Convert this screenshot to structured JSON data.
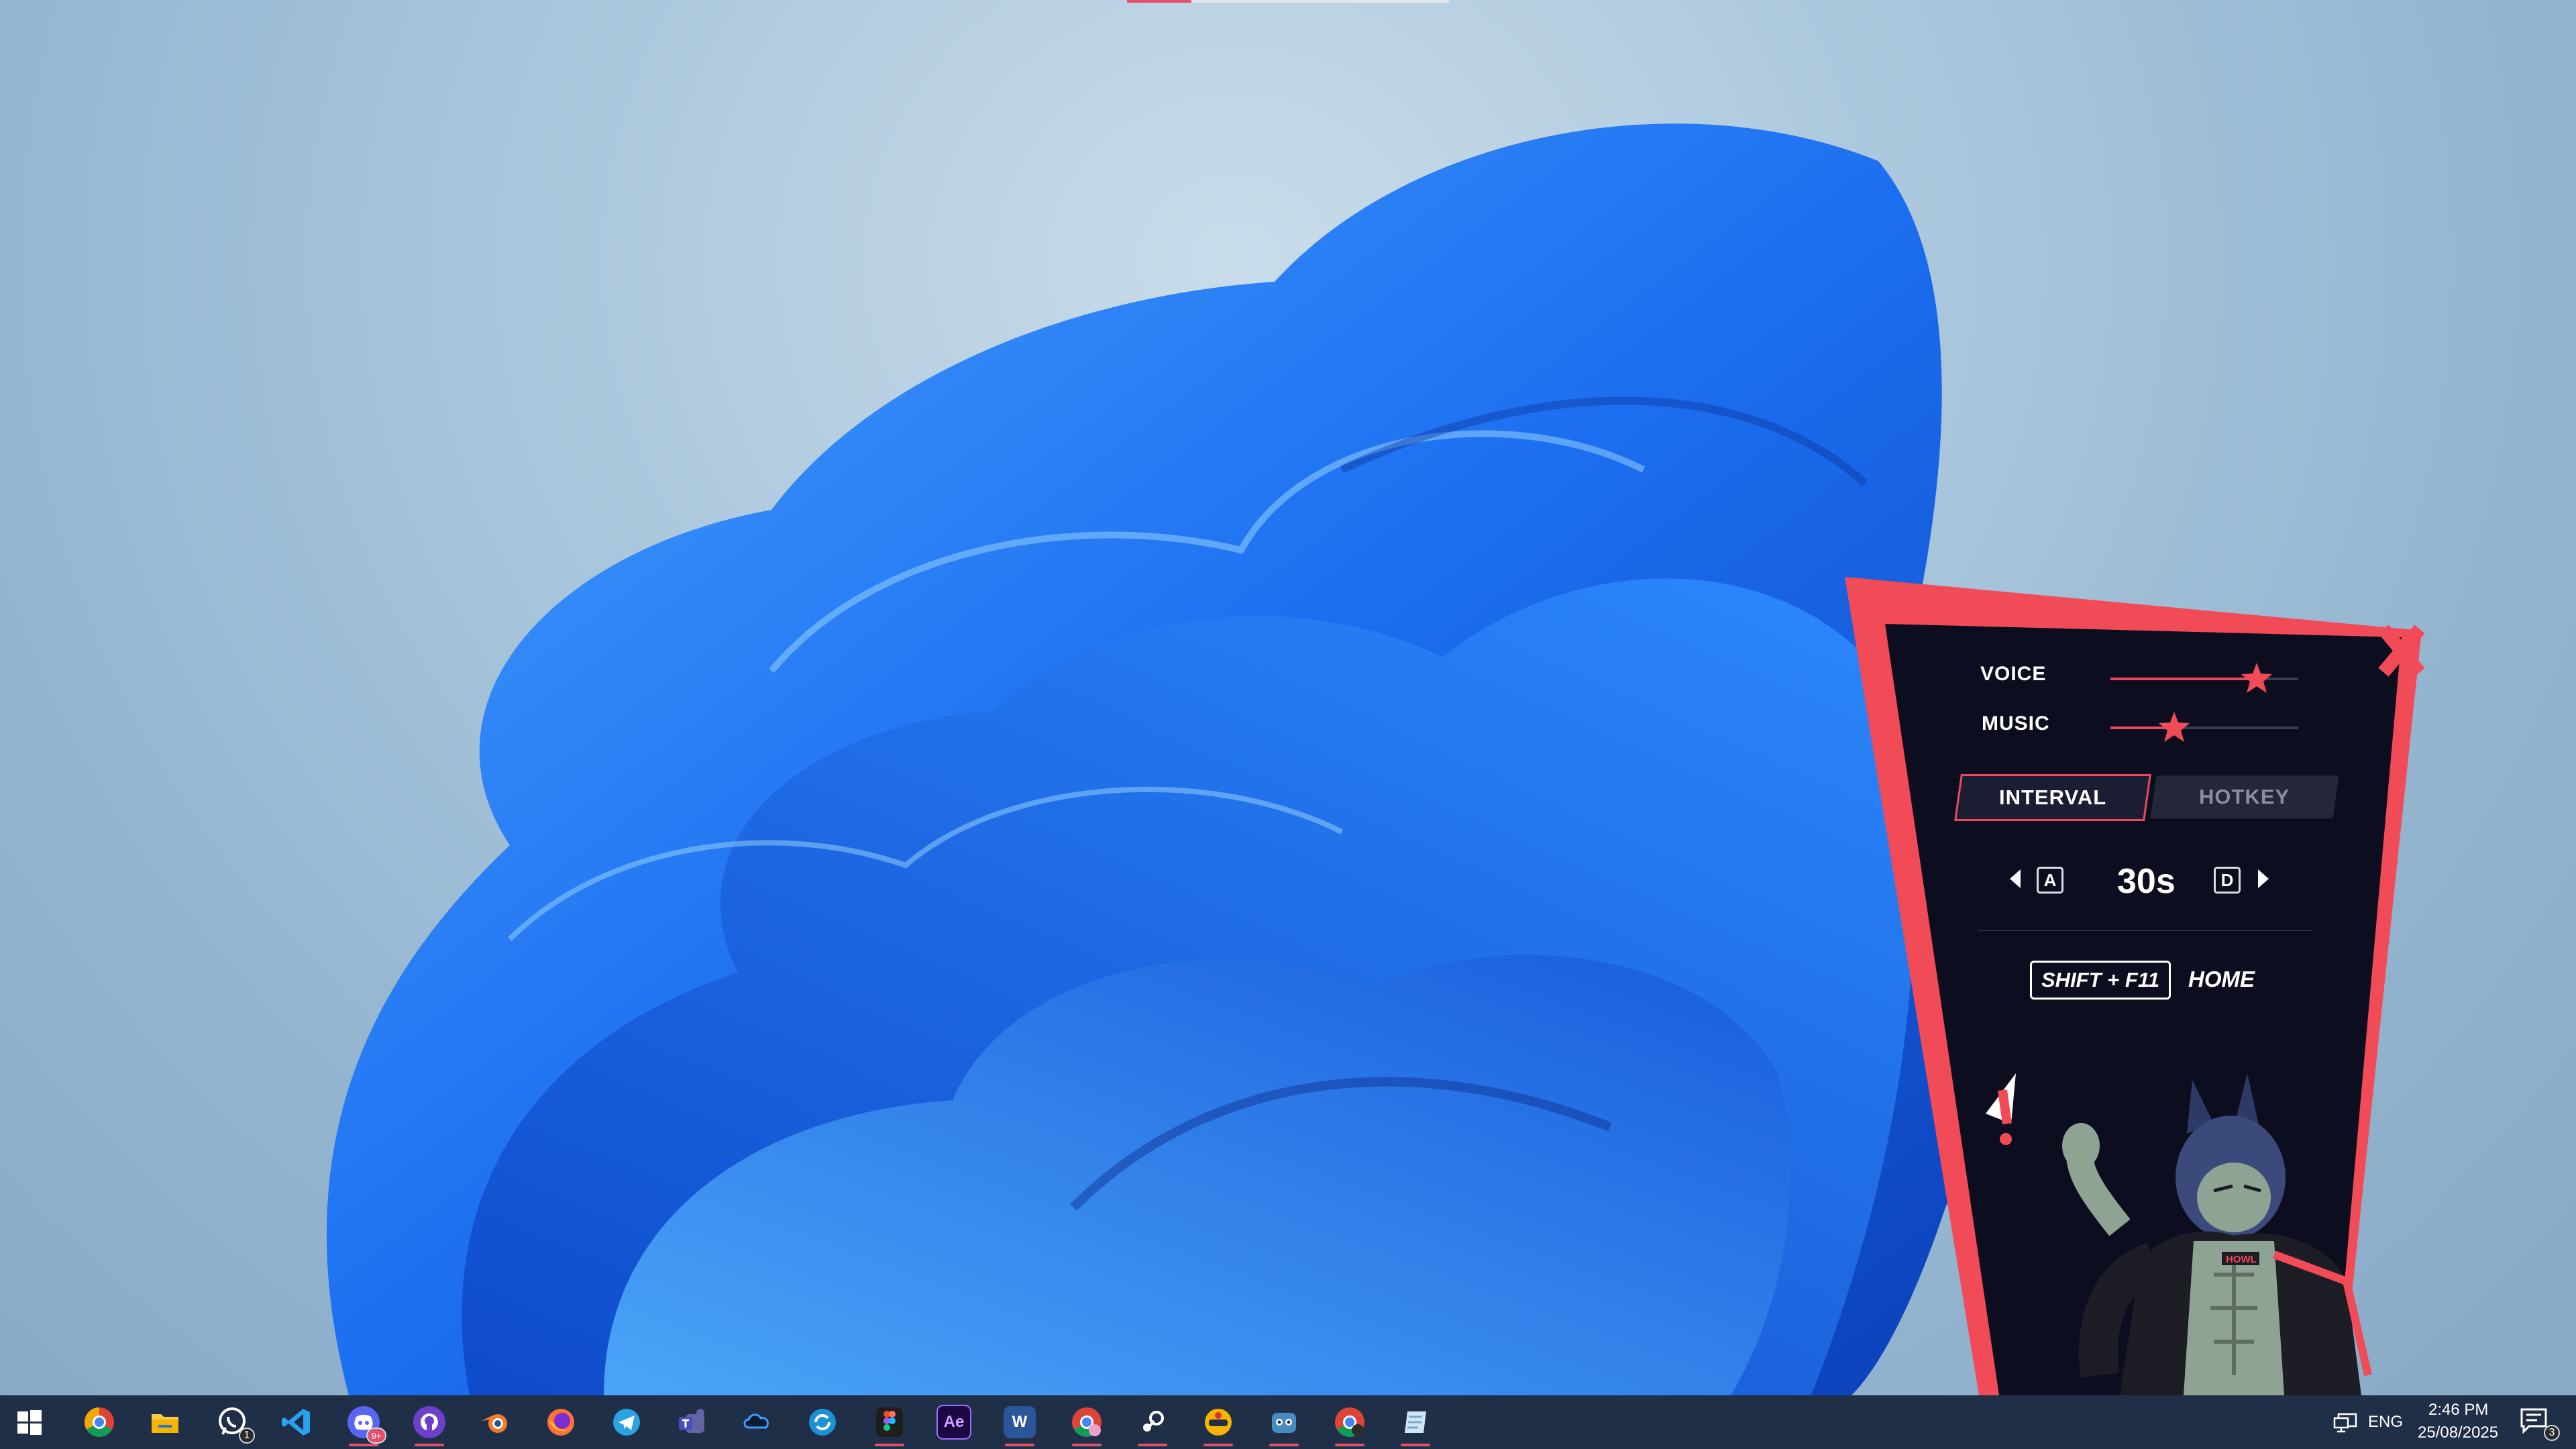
{
  "widget": {
    "voice_label": "VOICE",
    "voice_level": 0.78,
    "music_label": "MUSIC",
    "music_level": 0.34,
    "tabs": [
      {
        "label": "INTERVAL",
        "active": true
      },
      {
        "label": "HOTKEY",
        "active": false
      }
    ],
    "decrease_key": "A",
    "interval_value": "30s",
    "increase_key": "D",
    "hotkey_combo": "SHIFT + F11",
    "hotkey_action": "HOME",
    "colors": {
      "accent": "#e84a5c",
      "panel": "#0c0e1f",
      "frame": "#f24b58"
    }
  },
  "taskbar": {
    "icons": [
      {
        "name": "start-icon"
      },
      {
        "name": "chrome-icon"
      },
      {
        "name": "file-explorer-icon"
      },
      {
        "name": "whatsapp-icon",
        "badge": "1"
      },
      {
        "name": "vscode-icon"
      },
      {
        "name": "discord-icon",
        "badge": "9+",
        "active": true
      },
      {
        "name": "github-icon",
        "active": true
      },
      {
        "name": "blender-icon"
      },
      {
        "name": "firefox-icon"
      },
      {
        "name": "telegram-icon"
      },
      {
        "name": "teams-icon"
      },
      {
        "name": "cloud-app-icon"
      },
      {
        "name": "sync-app-icon"
      },
      {
        "name": "figma-icon",
        "active": true
      },
      {
        "name": "after-effects-icon",
        "text": "Ae"
      },
      {
        "name": "word-icon",
        "text": "W",
        "active": true
      },
      {
        "name": "chrome-profile-icon",
        "active": true
      },
      {
        "name": "steam-icon",
        "active": true
      },
      {
        "name": "game-app-icon",
        "active": true
      },
      {
        "name": "godot-icon",
        "active": true
      },
      {
        "name": "chrome-dev-icon",
        "active": true
      },
      {
        "name": "notes-app-icon",
        "active": true
      }
    ],
    "tray": {
      "language": "ENG",
      "time": "2:46 PM",
      "date": "25/08/2025",
      "notification_count": "3"
    }
  }
}
